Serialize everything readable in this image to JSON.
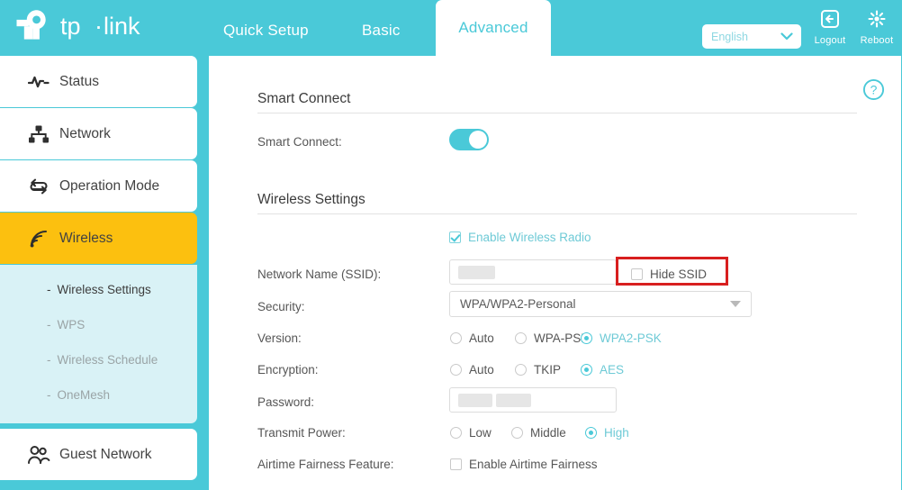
{
  "header": {
    "brand": "tp-link",
    "tabs": [
      {
        "label": "Quick Setup",
        "active": false
      },
      {
        "label": "Basic",
        "active": false
      },
      {
        "label": "Advanced",
        "active": true
      }
    ],
    "language": {
      "value": "English",
      "icon": "chevron-down-icon"
    },
    "logout": {
      "label": "Logout",
      "icon": "logout-icon"
    },
    "reboot": {
      "label": "Reboot",
      "icon": "reboot-icon"
    }
  },
  "sidebar": {
    "items": [
      {
        "label": "Status",
        "icon": "pulse-icon",
        "active": false
      },
      {
        "label": "Network",
        "icon": "sitemap-icon",
        "active": false
      },
      {
        "label": "Operation Mode",
        "icon": "cycle-arrows-icon",
        "active": false
      },
      {
        "label": "Wireless",
        "icon": "wifi-signal-icon",
        "active": true
      },
      {
        "label": "Guest Network",
        "icon": "people-icon",
        "active": false
      }
    ],
    "submenu": [
      {
        "label": "Wireless Settings",
        "active": true
      },
      {
        "label": "WPS",
        "active": false
      },
      {
        "label": "Wireless Schedule",
        "active": false
      },
      {
        "label": "OneMesh",
        "active": false
      }
    ],
    "submenu_dash": "-"
  },
  "content": {
    "help_icon": "help-circle-icon",
    "smart_connect": {
      "section_title": "Smart Connect",
      "row_label": "Smart Connect:",
      "toggle_state": "on"
    },
    "wireless_settings": {
      "section_title": "Wireless Settings",
      "enable_radio": {
        "label": "Enable Wireless Radio",
        "checked": true
      },
      "ssid": {
        "label": "Network Name (SSID):",
        "value": ""
      },
      "hide_ssid": {
        "label": "Hide SSID",
        "checked": false
      },
      "security": {
        "label": "Security:",
        "value": "WPA/WPA2-Personal"
      },
      "version": {
        "label": "Version:",
        "options": [
          "Auto",
          "WPA-PSK",
          "WPA2-PSK"
        ],
        "selected": "WPA2-PSK"
      },
      "encryption": {
        "label": "Encryption:",
        "options": [
          "Auto",
          "TKIP",
          "AES"
        ],
        "selected": "AES"
      },
      "password": {
        "label": "Password:",
        "value": ""
      },
      "transmit_power": {
        "label": "Transmit Power:",
        "options": [
          "Low",
          "Middle",
          "High"
        ],
        "selected": "High"
      },
      "airtime_fairness": {
        "label": "Airtime Fairness Feature:",
        "checkbox_label": "Enable Airtime Fairness",
        "checked": false
      }
    }
  },
  "annotation": {
    "color": "#d81f1f",
    "target": "hide-ssid-checkbox"
  }
}
